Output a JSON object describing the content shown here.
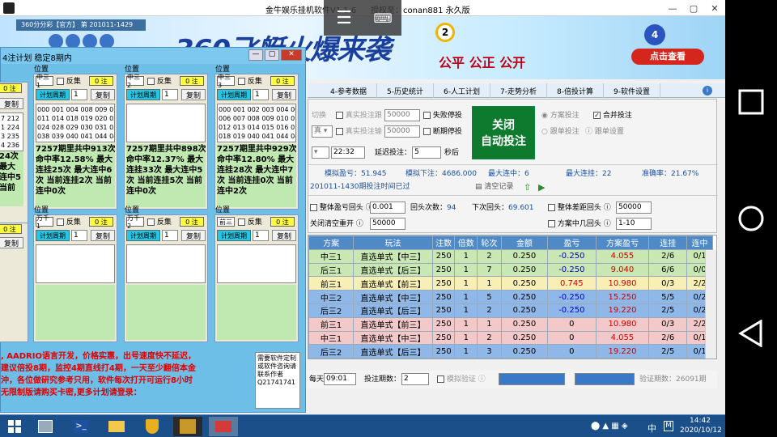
{
  "window": {
    "title": "金牛娱乐挂机软件V1.1.6",
    "auth": "授权至：conan881  永久版"
  },
  "banner": {
    "lottery": "360分分彩【官方】 第 201011-1429",
    "slogan_big": "360飞艇火爆来袭",
    "slogan": "公平 公正 公开",
    "cta": "点击查看"
  },
  "tabs": [
    "4-参考数据",
    "5-历史统计",
    "6-人工计划",
    "7-走势分析",
    "8-倍投计算",
    "9-软件设置"
  ],
  "planner": {
    "title": "4注计划 稳定8期内",
    "cells": [
      {
        "pos": "位置",
        "tag": "中三1",
        "fanji": "反集",
        "zhu": "0 注",
        "period": "计划周期",
        "num": "1",
        "btn": "复制",
        "nums": "000 001 004 008 009 010\n011 014 018 019 020 021\n024 028 029 030 031 034\n038 039 040 041 044 048",
        "stat": "7257期里共中913次\n命中率12.58% 最大\n连挂25次 最大连中6\n次 当前连挂2次 当前\n连中0次"
      },
      {
        "pos": "位置",
        "tag": "中三2",
        "fanji": "反集",
        "zhu": "0 注",
        "period": "计划周期",
        "num": "1",
        "btn": "复制",
        "nums": "",
        "stat": "7257期里共中898次\n命中率12.37% 最大\n连挂33次 最大连中5\n次 当前连挂5次 当前\n连中0次"
      },
      {
        "pos": "位置",
        "tag": "中三3",
        "fanji": "反集",
        "zhu": "0 注",
        "period": "计划周期",
        "num": "1",
        "btn": "复制",
        "nums": "000 001 002 003 004 005\n006 007 008 009 010 011\n012 013 014 015 016 017\n018 019 040 041 044 048",
        "stat": "7257期里共中929次\n命中率12.80% 最大\n连挂28次 最大连中7\n次 当前连挂0次 当前\n连中2次"
      },
      {
        "pos": "位置",
        "tag": "万千1",
        "fanji": "反集",
        "zhu": "0 注",
        "period": "计划周期",
        "num": "1",
        "btn": "复制",
        "nums": "",
        "stat": ""
      },
      {
        "pos": "位置",
        "tag": "万千2",
        "fanji": "反集",
        "zhu": "0 注",
        "period": "计划周期",
        "num": "1",
        "btn": "复制",
        "nums": "",
        "stat": ""
      },
      {
        "pos": "位置",
        "tag": "前三",
        "fanji": "反集",
        "zhu": "0 注",
        "period": "计划周期",
        "num": "1",
        "btn": "复制",
        "nums": "",
        "stat": ""
      }
    ],
    "left_partial": {
      "zhu": "0 注",
      "btn": "复制",
      "nums": "7 212\n1 224\n3 235\n4 236",
      "stat": "24次\n最大\n连中5\n当前\n"
    },
    "notice": ", AADRIO语言开发，价格实惠，出号速度快不延迟，\n建议倍投8期，监控4期直线打4期，一天至少翻倍本金\n沖，各位做研究参考只用，软件每次打开可运行8小时\n无限制版请购买卡密,更多计划请登录：",
    "contact": "需要软件定制或软件咨询请联系作者\nQ21741741"
  },
  "controls": {
    "switch": "切换",
    "real_bet": "真实投注跟",
    "amount1": "50000",
    "fail_stop": "失败停投",
    "real_bet2": "真实投注输",
    "amount2": "50000",
    "disconnect_stop": "断期停投",
    "auto_btn": "关闭\n自动投注",
    "scheme_bet": "方案投注",
    "merge_bet": "合并投注",
    "follow_bet": "跟单投注",
    "single_setting": "跟单设置",
    "time": "22:32",
    "delay_label": "延迟投注：",
    "delay": "5",
    "seconds": "秒后",
    "sim_profit_label": "模拟盈亏：",
    "sim_profit": "51.945",
    "sim_bet_label": "模拟下注：",
    "sim_bet": "4686.000",
    "max_win_label": "最大连中：",
    "max_win": "6",
    "max_lose_label": "最大连挂：",
    "max_lose": "22",
    "accuracy_label": "准确率：",
    "accuracy": "21.67%",
    "period_msg": "201011-1430期投注时间已过",
    "clear_log": "清空记录",
    "overall_label": "整体盈亏回头",
    "overall": "0.001",
    "back_count_label": "回头次数：",
    "back_count": "94",
    "next_back_label": "下次回头：",
    "next_back": "69.601",
    "overall_diff_label": "整体差距回头",
    "overall_diff": "50000",
    "close_clear_label": "关闭清空重开",
    "close_clear": "50000",
    "scheme_back_label": "方案中几回头",
    "scheme_back": "1-10"
  },
  "table": {
    "headers": [
      "方案",
      "玩法",
      "注数",
      "倍数",
      "轮次",
      "金额",
      "盈亏",
      "方案盈亏",
      "连挂",
      "连中"
    ],
    "rows": [
      {
        "c": [
          "中三1",
          "直选单式【中三】",
          "250",
          "1",
          "2",
          "0.250",
          "-0.250",
          "4.055",
          "2/6",
          "0/1"
        ],
        "bg": "#c9e7b3"
      },
      {
        "c": [
          "后三1",
          "直选单式【后三】",
          "250",
          "1",
          "7",
          "0.250",
          "-0.250",
          "9.040",
          "6/6",
          "0/0"
        ],
        "bg": "#c9e7b3"
      },
      {
        "c": [
          "前三1",
          "直选单式【前三】",
          "250",
          "1",
          "1",
          "0.250",
          "0.745",
          "10.980",
          "0/3",
          "2/2"
        ],
        "bg": "#f7efb5"
      },
      {
        "c": [
          "中三2",
          "直选单式【中三】",
          "250",
          "1",
          "5",
          "0.250",
          "-0.250",
          "15.250",
          "5/5",
          "0/2"
        ],
        "bg": "#8fb8e8"
      },
      {
        "c": [
          "后三2",
          "直选单式【后三】",
          "250",
          "1",
          "2",
          "0.250",
          "-0.250",
          "19.220",
          "2/5",
          "0/2"
        ],
        "bg": "#8fb8e8"
      },
      {
        "c": [
          "前三1",
          "直选单式【前三】",
          "250",
          "1",
          "1",
          "0.250",
          "0",
          "10.980",
          "0/3",
          "2/2"
        ],
        "bg": "#f3c8c8"
      },
      {
        "c": [
          "中三1",
          "直选单式【中三】",
          "250",
          "1",
          "2",
          "0.250",
          "0",
          "4.055",
          "2/6",
          "0/1"
        ],
        "bg": "#f3c8c8"
      },
      {
        "c": [
          "后三2",
          "直选单式【后三】",
          "250",
          "1",
          "3",
          "0.250",
          "0",
          "19.220",
          "2/5",
          "0/1"
        ],
        "bg": "#8fb8e8"
      }
    ]
  },
  "bottom": {
    "every_day": "每天",
    "time": "09:01",
    "bet_periods_label": "投注期数：",
    "bet_periods": "2",
    "sim_verify": "模拟验证",
    "verify_periods_label": "验证期数：",
    "verify_periods": "26091期"
  },
  "taskbar": {
    "time": "14:42",
    "date": "2020/10/12",
    "ime": "中",
    "m": "M"
  },
  "colors": {
    "accent": "#2a7fb8",
    "green_btn": "#0e7a2e",
    "header": "#4f8ac6"
  }
}
